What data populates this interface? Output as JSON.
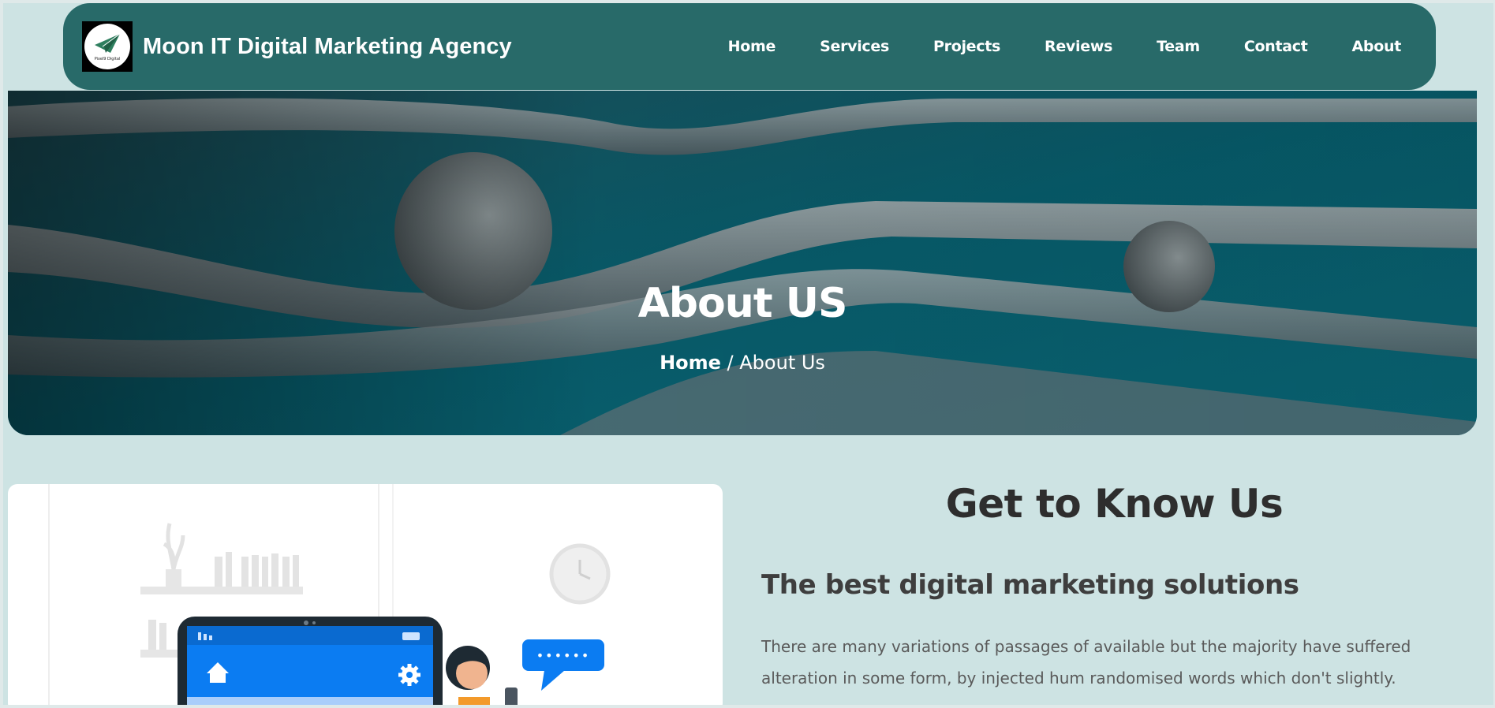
{
  "brand": {
    "name": "Moon IT Digital Marketing Agency",
    "logo_caption": "Pixel9 Digital"
  },
  "nav": {
    "items": [
      {
        "label": "Home"
      },
      {
        "label": "Services"
      },
      {
        "label": "Projects"
      },
      {
        "label": "Reviews"
      },
      {
        "label": "Team"
      },
      {
        "label": "Contact"
      },
      {
        "label": "About"
      }
    ]
  },
  "hero": {
    "title": "About US",
    "breadcrumb": {
      "home": "Home",
      "separator": " / ",
      "current": "About Us"
    }
  },
  "about": {
    "heading": "Get to Know Us",
    "subheading": "The best digital marketing solutions",
    "body": "There are many variations of passages of available but the majority have suffered alteration in some form, by injected hum randomised words which don't slightly."
  },
  "illustration": {
    "chat_bubble": "••••••"
  },
  "colors": {
    "nav_bg": "#286a69",
    "page_bg": "#cde3e3",
    "hero_teal": "#0b6b78",
    "accent_blue": "#0b7cf2"
  },
  "icons": [
    "paper-plane-logo-icon",
    "home-icon",
    "gear-icon",
    "clock-icon",
    "chat-bubble-icon"
  ]
}
